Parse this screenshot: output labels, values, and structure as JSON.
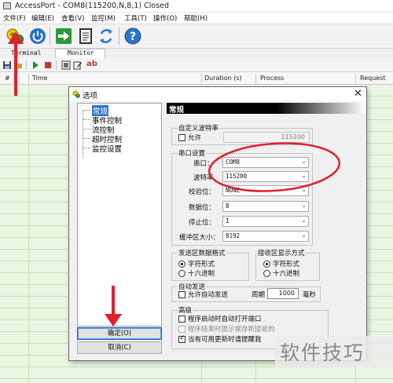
{
  "window": {
    "title": "AccessPort - COM8(115200,N,8,1) Closed"
  },
  "menubar": [
    "文件(F)",
    "编辑(E)",
    "查看(V)",
    "监控(M)",
    "工具(T)",
    "操作(O)",
    "帮助(H)"
  ],
  "tabs": [
    "Terminal",
    "Monitor"
  ],
  "toolbar2": {
    "ab_label": "ab"
  },
  "columns": [
    "#",
    "Time",
    "Duration (s)",
    "Process",
    "Request"
  ],
  "dialog": {
    "title": "选项",
    "tree": [
      "常规",
      "事件控制",
      "流控制",
      "超时控制",
      "监控设置"
    ],
    "ok_label": "确定(O)",
    "cancel_label": "取消(C)",
    "section_title": "常规",
    "custom_baud": {
      "group": "自定义波特率",
      "allow": "允许",
      "value": "115200"
    },
    "serial": {
      "group": "串口设置",
      "port_label": "串口：",
      "port": "COM8",
      "baud_label": "波特率",
      "baud": "115200",
      "parity_label": "校验位：",
      "parity": "NONE",
      "data_label": "数据位：",
      "data": "8",
      "stop_label": "停止位：",
      "stop": "1",
      "buffer_label": "缓冲区大小：",
      "buffer": "8192"
    },
    "send_format": {
      "group": "发送区数据格式",
      "char": "字符形式",
      "hex": "十六进制"
    },
    "recv_format": {
      "group": "接收区显示方式",
      "char": "字符形式",
      "hex": "十六进制"
    },
    "auto_send": {
      "group": "自动发送",
      "allow": "允许自动发送",
      "period_label": "周期",
      "period": "1000",
      "unit": "毫秒"
    },
    "advanced": {
      "group": "高级",
      "open_on_start": "程序启动时自动打开端口",
      "prompt_on_exit": "程序结束时提示保存新接收的",
      "check_update": "当有可用更新时请提醒我"
    }
  },
  "watermark": "软件技巧",
  "colors": {
    "grid": "#eaf6e2",
    "gridline": "#c6e2b4",
    "annotation": "#e0202a",
    "selection": "#3272c8"
  }
}
